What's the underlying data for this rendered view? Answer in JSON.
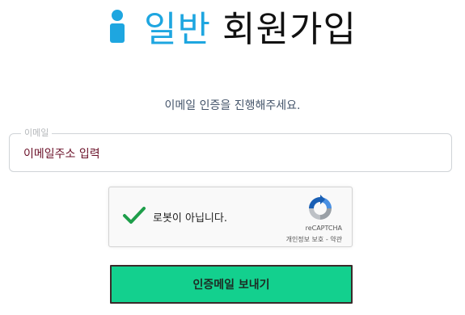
{
  "header": {
    "title_accent": "일반",
    "title_main": "회원가입",
    "icon": "user-icon",
    "accent_color": "#1ea6e0"
  },
  "instruction": "이메일 인증을 진행해주세요.",
  "email_field": {
    "legend": "이메일",
    "value": "이메일주소 입력"
  },
  "captcha": {
    "label": "로봇이 아닙니다.",
    "checked": true,
    "brand": "reCAPTCHA",
    "privacy_link": "개인정보 보호",
    "separator": " - ",
    "terms_link": "약관"
  },
  "submit_button": {
    "label": "인증메일 보내기",
    "color": "#13d08e"
  }
}
